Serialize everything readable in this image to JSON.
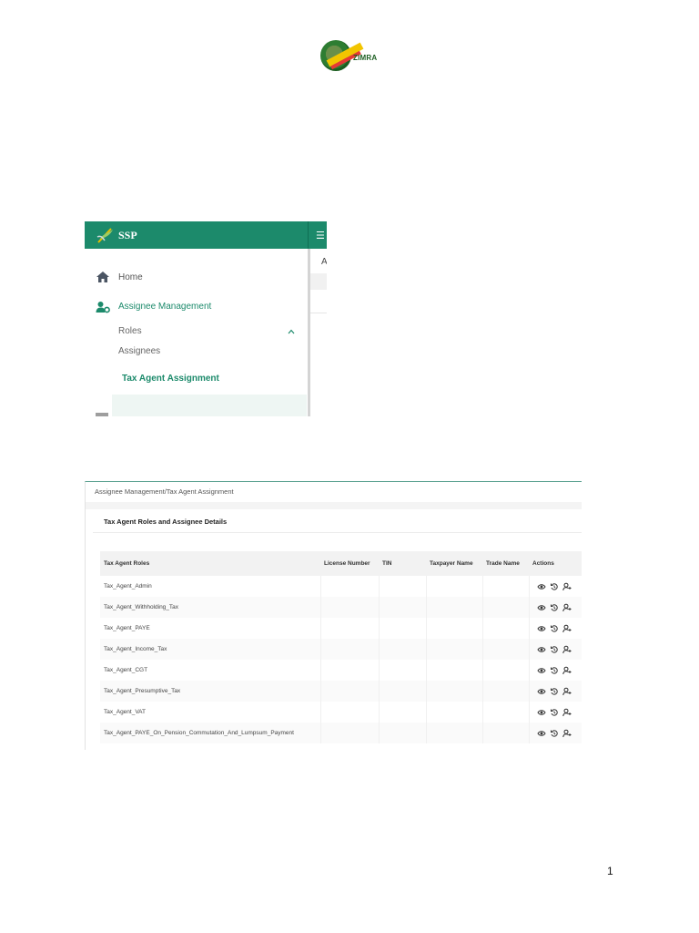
{
  "logo": {
    "text": "ZIMRA"
  },
  "sidebar": {
    "brand": "SSP",
    "content_initial": "A",
    "items": [
      {
        "label": "Home",
        "icon": "home-icon"
      },
      {
        "label": "Assignee Management",
        "icon": "user-settings-icon"
      },
      {
        "label": "Roles"
      },
      {
        "label": "Assignees"
      },
      {
        "label": "Tax Agent Assignment"
      }
    ],
    "active_color": "#1c8a6b"
  },
  "table_view": {
    "breadcrumb": "Assignee Management/Tax Agent Assignment",
    "title": "Tax Agent Roles and Assignee Details",
    "columns": [
      "Tax Agent Roles",
      "License Number",
      "TIN",
      "Taxpayer Name",
      "Trade Name",
      "Actions"
    ],
    "rows": [
      [
        "Tax_Agent_Admin",
        "",
        "",
        "",
        ""
      ],
      [
        "Tax_Agent_Withholding_Tax",
        "",
        "",
        "",
        ""
      ],
      [
        "Tax_Agent_PAYE",
        "",
        "",
        "",
        ""
      ],
      [
        "Tax_Agent_Income_Tax",
        "",
        "",
        "",
        ""
      ],
      [
        "Tax_Agent_CGT",
        "",
        "",
        "",
        ""
      ],
      [
        "Tax_Agent_Presumptive_Tax",
        "",
        "",
        "",
        ""
      ],
      [
        "Tax_Agent_VAT",
        "",
        "",
        "",
        ""
      ],
      [
        "Tax_Agent_PAYE_On_Pension_Commutation_And_Lumpsum_Payment",
        "",
        "",
        "",
        ""
      ]
    ],
    "action_icons": [
      "view-icon",
      "history-icon",
      "assign-user-icon"
    ]
  },
  "page_number": "1"
}
